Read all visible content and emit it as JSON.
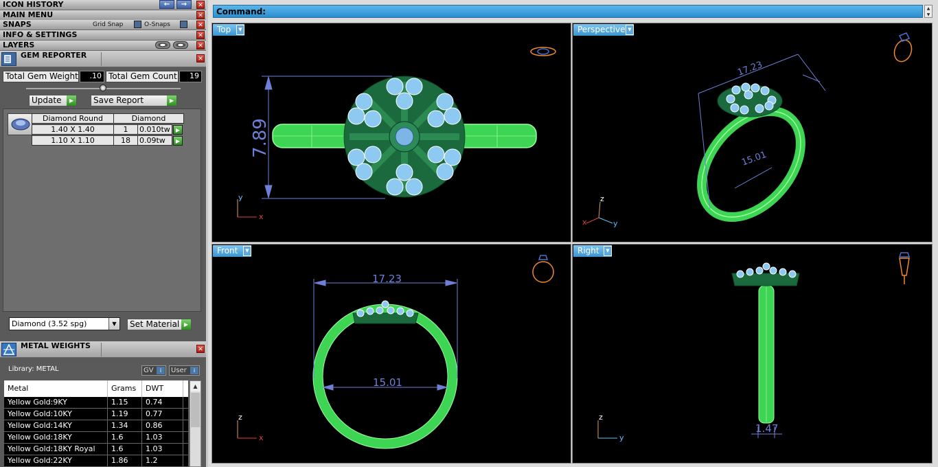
{
  "menu_bars": {
    "icon_history": "ICON HISTORY",
    "main_menu": "MAIN MENU",
    "snaps": "SNAPS",
    "grid_snap": "Grid Snap",
    "o_snaps": "O-Snaps",
    "info_settings": "INFO & SETTINGS",
    "layers": "LAYERS",
    "close_glyph": "✕"
  },
  "gem_reporter": {
    "title": "GEM REPORTER",
    "total_weight_label": "Total Gem Weight",
    "total_weight_value": ".10",
    "total_count_label": "Total Gem Count",
    "total_count_value": "19",
    "update_button": "Update",
    "save_report_button": "Save Report",
    "table_headers": [
      "Diamond Round",
      "Diamond"
    ],
    "rows": [
      {
        "size": "1.40 X 1.40",
        "count": "1",
        "weight": "0.010tw"
      },
      {
        "size": "1.10 X 1.10",
        "count": "18",
        "weight": "0.09tw"
      }
    ],
    "material_select": "Diamond    (3.52 spg)",
    "set_material_button": "Set Material"
  },
  "metal_weights": {
    "title": "METAL WEIGHTS",
    "library": "Library: METAL",
    "gv_button": "GV",
    "user_button": "User",
    "columns": [
      "Metal",
      "Grams",
      "DWT"
    ],
    "rows": [
      {
        "metal": "Yellow Gold:9KY",
        "grams": "1.15",
        "dwt": "0.74"
      },
      {
        "metal": "Yellow Gold:10KY",
        "grams": "1.19",
        "dwt": "0.77"
      },
      {
        "metal": "Yellow Gold:14KY",
        "grams": "1.34",
        "dwt": "0.86"
      },
      {
        "metal": "Yellow Gold:18KY",
        "grams": "1.6",
        "dwt": "1.03"
      },
      {
        "metal": "Yellow Gold:18KY Royal",
        "grams": "1.6",
        "dwt": "1.03"
      },
      {
        "metal": "Yellow Gold:22KY",
        "grams": "1.86",
        "dwt": "1.2"
      }
    ]
  },
  "command": {
    "label": "Command:"
  },
  "viewports": {
    "top": {
      "label": "Top",
      "dim_height": "7.89"
    },
    "perspective": {
      "label": "Perspective",
      "dim_width": "17.23",
      "dim_diameter": "15.01"
    },
    "front": {
      "label": "Front",
      "dim_width": "17.23",
      "dim_diameter": "15.01"
    },
    "right": {
      "label": "Right",
      "dim_thickness": "1.47"
    }
  },
  "axes": {
    "x": "x",
    "y": "y",
    "z": "z"
  },
  "colors": {
    "accent_blue": "#2a8fd0",
    "ring_green": "#3fe05a",
    "gem_blue": "#8ec9f2",
    "dimension": "#6f7fd6",
    "viewport_bg": "#000000"
  }
}
